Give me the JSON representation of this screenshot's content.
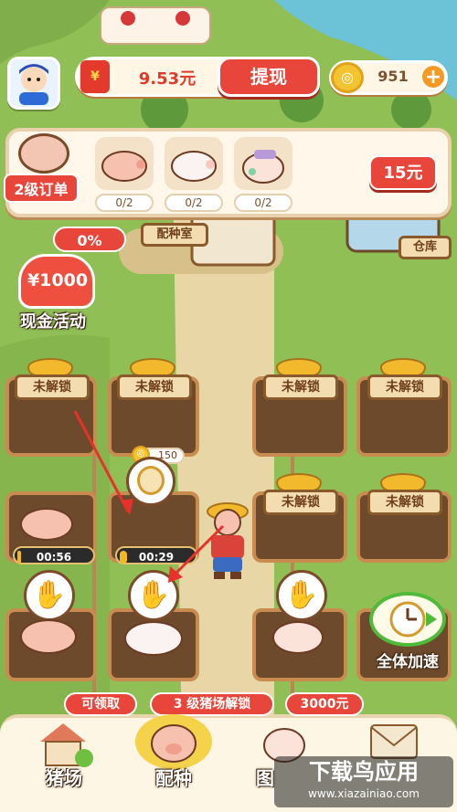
{
  "header": {
    "cash_icon": "¥",
    "cash_value": "9.53元",
    "withdraw_label": "提现",
    "coin_value": "951",
    "coin_plus": "+"
  },
  "order": {
    "badge": "2级订单",
    "slots": [
      {
        "count": "0/2",
        "pig": "pink-pig"
      },
      {
        "count": "0/2",
        "pig": "white-pig"
      },
      {
        "count": "0/2",
        "pig": "baby-pig"
      }
    ],
    "price": "15元"
  },
  "buildings": {
    "breeding_room": "配种室",
    "warehouse": "仓库"
  },
  "cash_event": {
    "progress": "0%",
    "amount": "¥1000",
    "label": "现金活动"
  },
  "plots": {
    "locked_label": "未解锁",
    "timers": [
      "00:56",
      "00:29"
    ],
    "timer_progress": [
      0.05,
      0.1
    ],
    "clock_cost": "150",
    "speedup_label": "全体加速"
  },
  "nav": {
    "tips": [
      "可领取",
      "3 级猪场解锁",
      "3000元"
    ],
    "items": [
      "猪场",
      "配种",
      "图"
    ]
  },
  "watermark": {
    "text": "下载鸟应用",
    "url": "www.xiazainiao.com"
  },
  "colors": {
    "accent_red": "#e8463a",
    "grass": "#8fbf55",
    "coin": "#f4c330"
  }
}
